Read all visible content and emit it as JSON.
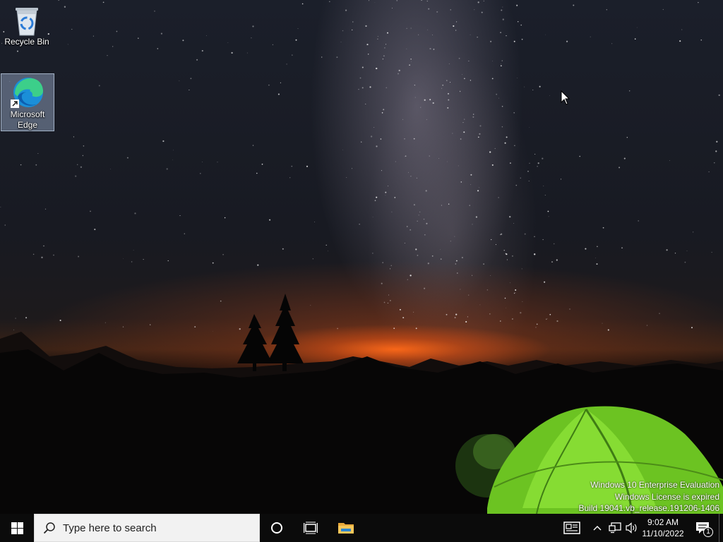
{
  "desktop": {
    "icons": [
      {
        "id": "recycle-bin",
        "label": "Recycle Bin",
        "icon": "recycle-bin-icon"
      },
      {
        "id": "microsoft-edge",
        "label": "Microsoft Edge",
        "icon": "edge-icon",
        "selected": true
      }
    ],
    "watermark": {
      "line1": "Windows 10 Enterprise Evaluation",
      "line2": "Windows License is expired",
      "line3": "Build 19041.vb_release.191206-1406"
    }
  },
  "taskbar": {
    "start_icon": "windows-logo-icon",
    "search": {
      "placeholder": "Type here to search",
      "icon": "search-icon"
    },
    "pinned": [
      {
        "name": "cortana",
        "icon": "circle-icon"
      },
      {
        "name": "task-view",
        "icon": "task-view-icon"
      },
      {
        "name": "file-explorer",
        "icon": "folder-icon"
      }
    ],
    "tray": {
      "news_icon": "news-icon",
      "chevron_icon": "chevron-up-icon",
      "network_icon": "network-icon",
      "volume_icon": "speaker-icon",
      "time": "9:02 AM",
      "date": "11/10/2022",
      "notification_count": "1"
    }
  },
  "colors": {
    "taskbar_bg": "#0b0b0b",
    "search_bg": "#f2f2f2",
    "selection_bg": "#a0b4d2",
    "tent_green": "#7fd628",
    "sunset_orange": "#ff6a19"
  }
}
